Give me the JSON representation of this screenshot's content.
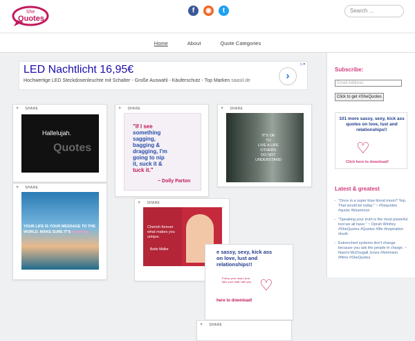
{
  "header": {
    "logo_top": "She",
    "logo_main": "Quotes",
    "social": [
      {
        "icon": "facebook-icon",
        "glyph": "f",
        "color": "#3b5998"
      },
      {
        "icon": "rss-icon",
        "glyph": "◉",
        "color": "#f26522"
      },
      {
        "icon": "twitter-icon",
        "glyph": "t",
        "color": "#1da1f2"
      }
    ],
    "search_placeholder": "Search ..."
  },
  "nav": {
    "home": "Home",
    "about": "About",
    "categories": "Quote Categories"
  },
  "ad": {
    "title": "LED Nachtlicht 16,95€",
    "desc": "Hochwertige LED Steckdosenleuchte mit Schalter - Große Auswahl - Käuferschutz - Top Marken",
    "url": "saasil.de",
    "arrow": "›"
  },
  "share_label": "SHARE",
  "cards": {
    "c1": {
      "text": "Hallelujah.",
      "brand": "Quotes"
    },
    "c2": {
      "line1": "\"If I see",
      "line2": "something",
      "line3": "sagging,",
      "line4": "bagging &",
      "line5": "dragging, I'm",
      "line6": "going to nip",
      "line7": "it, suck it &",
      "line8": "tuck it.\"",
      "author": "~ Dolly Parton"
    },
    "c3": {
      "line1": "IT'S OK",
      "line2": "TO",
      "line3": "LIVE A LIFE",
      "line4": "OTHERS",
      "line5": "DO NOT",
      "line6": "UNDERSTAND"
    },
    "c4": {
      "line1": "YOUR LIFE IS YOUR MESSAGE TO THE",
      "line2": "WORLD. MAKE SURE IT'S",
      "line3": "inspiring."
    },
    "c5": {
      "quote1": "Cherish forever",
      "quote2": "what makes you",
      "quote3": "unique.",
      "author": "Bette Midler"
    },
    "c6": {
      "line1": "e sassy, sexy, kick ass",
      "line2": "on love, lust and",
      "line3": "relationships!!",
      "note": "Follow your heart, And take your brain with you.",
      "cta": "here to download!"
    }
  },
  "sidebar": {
    "subscribe_title": "Subscribe:",
    "email_placeholder": "Email Address",
    "button": "Click to get #SheQuotes",
    "promo_title": "101 more sassy, sexy, kick ass quotes on love, lust and relationships!!",
    "promo_cta": "Click here to download!",
    "latest_title": "Latest & greatest",
    "latest": [
      "\"Once in a super blue blood moon? Yep. That would be today.\" ~ #Sequotes #quote #bluemoon",
      "\"Speaking your truth is the most powerful tool we all have.\" ~ Oprah Winfrey #SheQuotes #Quotes #life #inspiration #truth",
      "Entrenched systems don't change because you ask the people in charge. ~ Naomi McDougall Jones #feminism #films #SheQuotes"
    ]
  }
}
